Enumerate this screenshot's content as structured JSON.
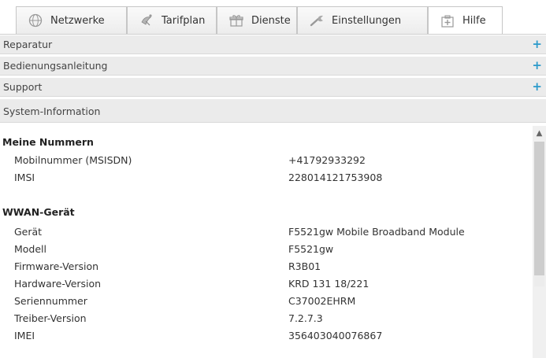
{
  "tabs": [
    {
      "label": "Netzwerke",
      "icon": "globe-icon"
    },
    {
      "label": "Tarifplan",
      "icon": "satellite-dish-icon"
    },
    {
      "label": "Dienste",
      "icon": "gift-icon"
    },
    {
      "label": "Einstellungen",
      "icon": "wrench-icon"
    },
    {
      "label": "Hilfe",
      "icon": "first-aid-kit-icon"
    }
  ],
  "accordion": [
    {
      "label": "Reparatur",
      "toggle": "+"
    },
    {
      "label": "Bedienungsanleitung",
      "toggle": "+"
    },
    {
      "label": "Support",
      "toggle": "+"
    },
    {
      "label": "System-Information",
      "toggle": ""
    }
  ],
  "system_info": {
    "sections": [
      {
        "title": "Meine Nummern",
        "rows": [
          {
            "label": "Mobilnummer (MSISDN)",
            "value": "+41792933292"
          },
          {
            "label": "IMSI",
            "value": "228014121753908"
          }
        ]
      },
      {
        "title": "WWAN-Gerät",
        "rows": [
          {
            "label": "Gerät",
            "value": "F5521gw Mobile Broadband Module"
          },
          {
            "label": "Modell",
            "value": "F5521gw"
          },
          {
            "label": "Firmware-Version",
            "value": "R3B01"
          },
          {
            "label": "Hardware-Version",
            "value": "KRD 131 18/221"
          },
          {
            "label": "Seriennummer",
            "value": "C37002EHRM"
          },
          {
            "label": "Treiber-Version",
            "value": "7.2.7.3"
          },
          {
            "label": "IMEI",
            "value": "356403040076867"
          }
        ]
      }
    ]
  },
  "colors": {
    "accent_plus": "#2b9acb",
    "header_bg": "#ebebeb"
  }
}
